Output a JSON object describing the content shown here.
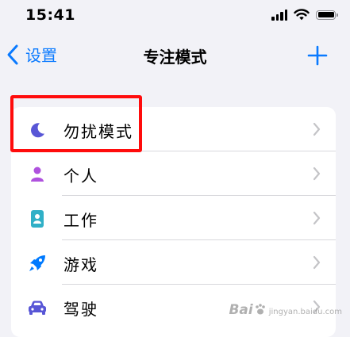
{
  "status_bar": {
    "time": "15:41",
    "icons": [
      "cellular-signal-icon",
      "wifi-icon",
      "battery-icon"
    ]
  },
  "nav": {
    "back_label": "设置",
    "title": "专注模式",
    "add_icon": "plus-icon",
    "accent_color": "#0a7aff"
  },
  "focus_modes": [
    {
      "label": "勿扰模式",
      "icon": "moon-icon",
      "icon_color": "#5856d6"
    },
    {
      "label": "个人",
      "icon": "person-icon",
      "icon_color": "#af52de"
    },
    {
      "label": "工作",
      "icon": "id-badge-icon",
      "icon_color": "#30b0c7"
    },
    {
      "label": "游戏",
      "icon": "rocket-icon",
      "icon_color": "#007aff"
    },
    {
      "label": "驾驶",
      "icon": "car-icon",
      "icon_color": "#5856d6"
    }
  ],
  "annotation": {
    "highlight_color": "#ff0c0c"
  },
  "watermark": {
    "text": "Bai",
    "sub": "jingyan.baidu.com"
  }
}
